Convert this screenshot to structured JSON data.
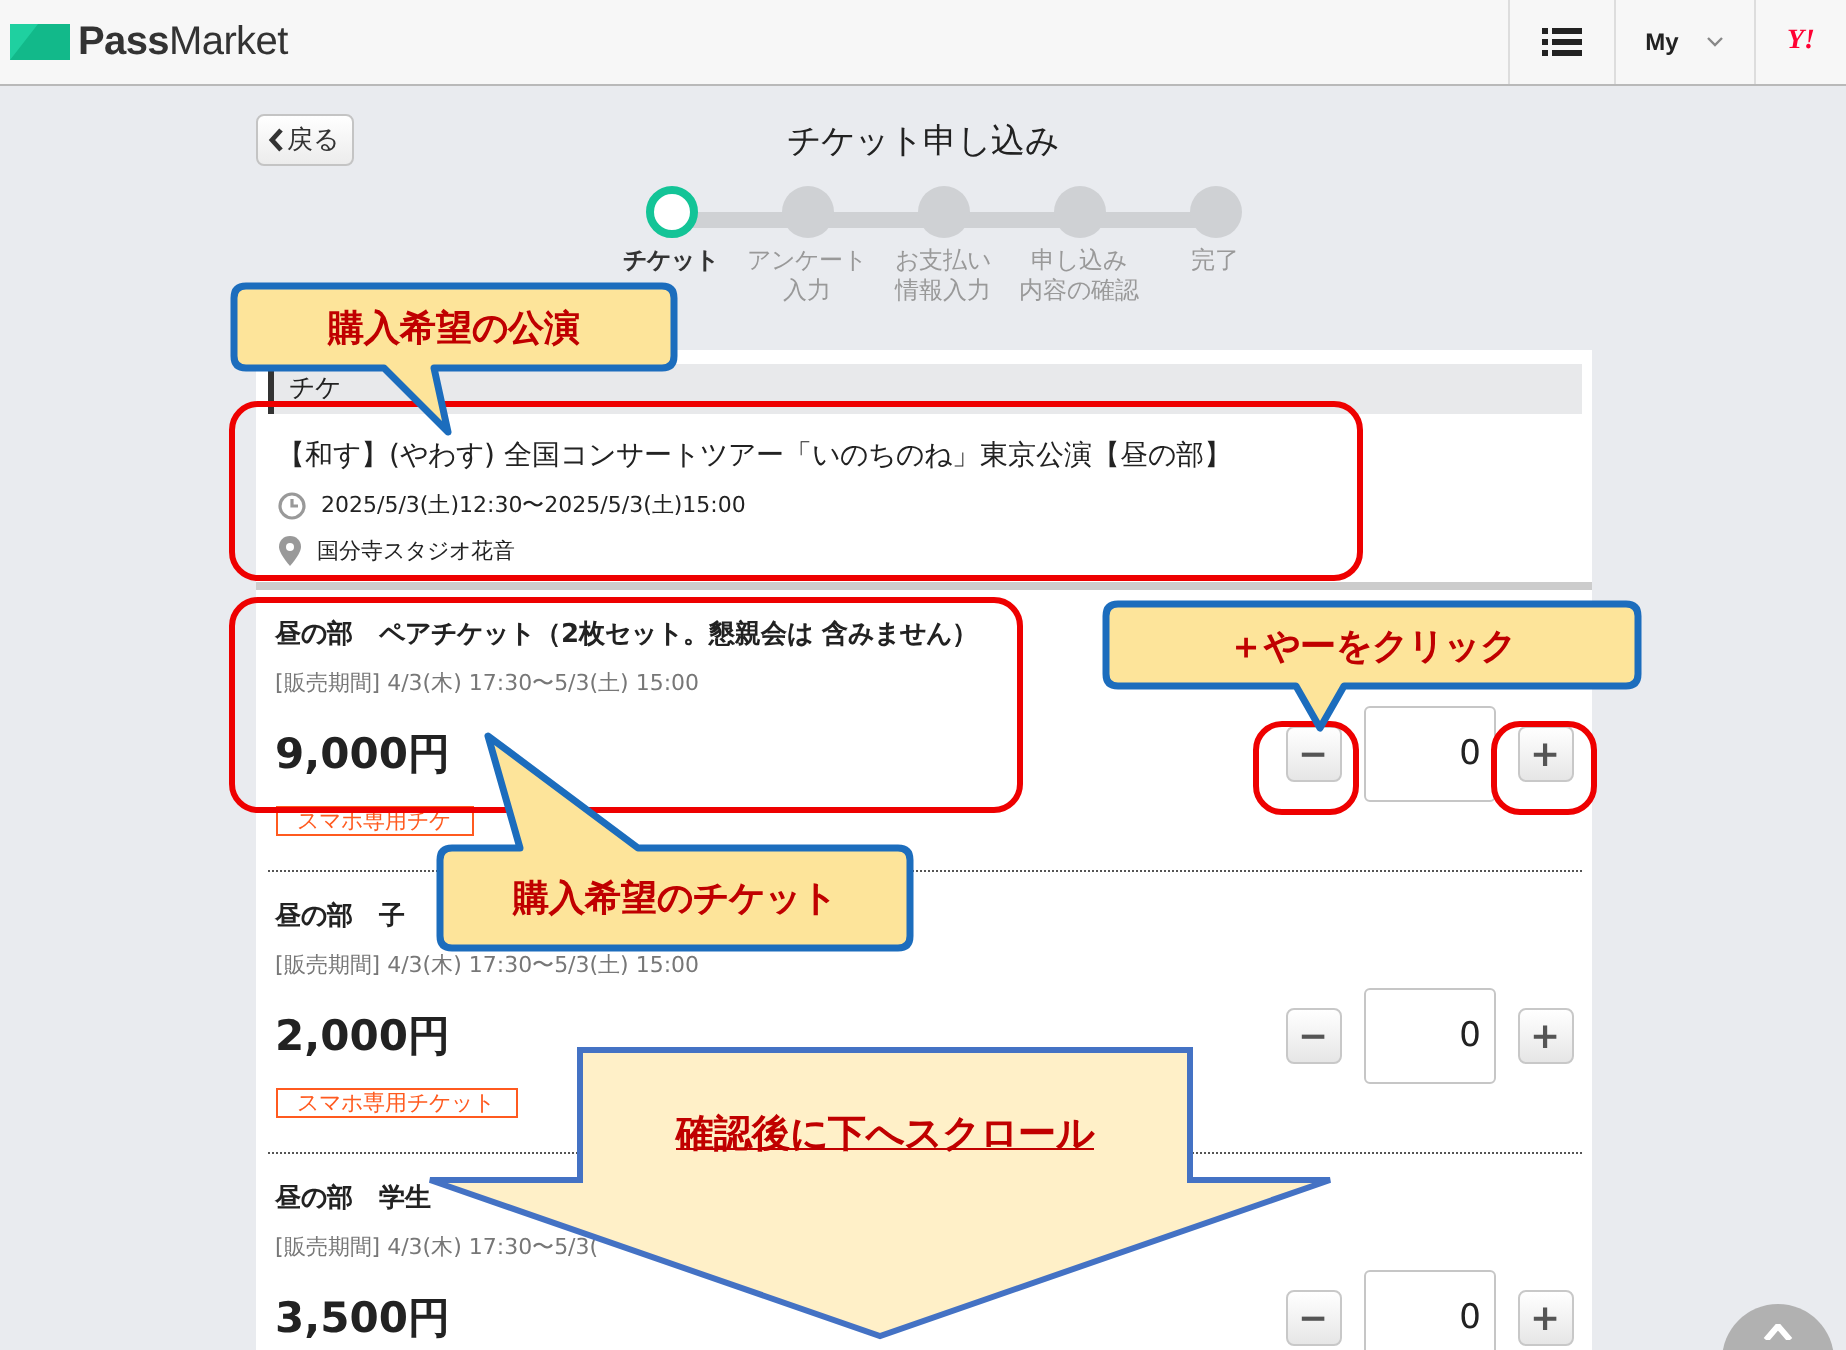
{
  "header": {
    "logo": "**Pass**Market",
    "my": "My",
    "yahoo": "Y!"
  },
  "back_button": "戻る",
  "page_title": "チケット申し込み",
  "steps": [
    {
      "lines": [
        "チケット"
      ],
      "selected": true
    },
    {
      "lines": [
        "アンケート",
        "入力"
      ],
      "selected": false
    },
    {
      "lines": [
        "お支払い",
        "情報入力"
      ],
      "selected": false
    },
    {
      "lines": [
        "申し込み",
        "内容の確認"
      ],
      "selected": false
    },
    {
      "lines": [
        "完了"
      ],
      "selected": false
    }
  ],
  "section_header": "チケ",
  "event": {
    "title": "【和す】(やわす) 全国コンサートツアー「いのちのね」東京公演【昼の部】",
    "datetime": "2025/5/3(土)12:30〜2025/5/3(土)15:00",
    "venue": "国分寺スタジオ花音"
  },
  "tickets": [
    {
      "name": "昼の部　ペアチケット（2枚セット。懇親会は 含みません）",
      "period": "[販売期間] 4/3(木) 17:30〜5/3(土) 15:00",
      "price": "9,000円",
      "badge": "スマホ専用チケ",
      "minus": "−",
      "quantity": "0",
      "plus": "+"
    },
    {
      "name": "昼の部　子",
      "period": "[販売期間] 4/3(木) 17:30〜5/3(土) 15:00",
      "price": "2,000円",
      "badge": "スマホ専用チケット",
      "minus": "−",
      "quantity": "0",
      "plus": "+"
    },
    {
      "name": "昼の部　学生",
      "period": "[販売期間] 4/3(木) 17:30〜5/3(",
      "price": "3,500円",
      "minus": "−",
      "quantity": "0",
      "plus": "+"
    }
  ],
  "annotations": [
    {
      "kind": "callout",
      "text": "購入希望の公演"
    },
    {
      "kind": "callout",
      "text": "＋やーをクリック"
    },
    {
      "kind": "callout",
      "text": "購入希望のチケット"
    },
    {
      "kind": "arrow",
      "text": "確認後に下へスクロール"
    }
  ]
}
